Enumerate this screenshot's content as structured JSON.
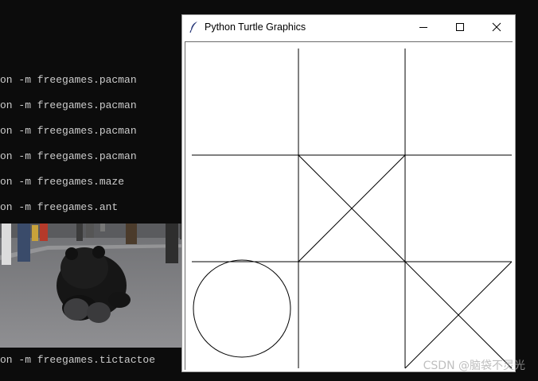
{
  "terminal": {
    "lines": [
      "on -m freegames.pacman",
      "on -m freegames.pacman",
      "on -m freegames.pacman",
      "on -m freegames.pacman",
      "on -m freegames.maze",
      "on -m freegames.ant",
      "on -m freegames.tictactoe"
    ]
  },
  "window": {
    "title": "Python Turtle Graphics",
    "icon": "feather-icon",
    "controls": {
      "minimize": "minimize-icon",
      "maximize": "maximize-icon",
      "close": "close-icon"
    }
  },
  "game": {
    "board": [
      [
        "",
        "",
        ""
      ],
      [
        "",
        "X",
        ""
      ],
      [
        "O",
        "",
        "X"
      ]
    ]
  },
  "watermark": "CSDN @脑袋不灵光",
  "colors": {
    "terminal_bg": "#0c0c0c",
    "terminal_text": "#cccccc",
    "canvas_bg": "#ffffff",
    "line": "#000000"
  }
}
